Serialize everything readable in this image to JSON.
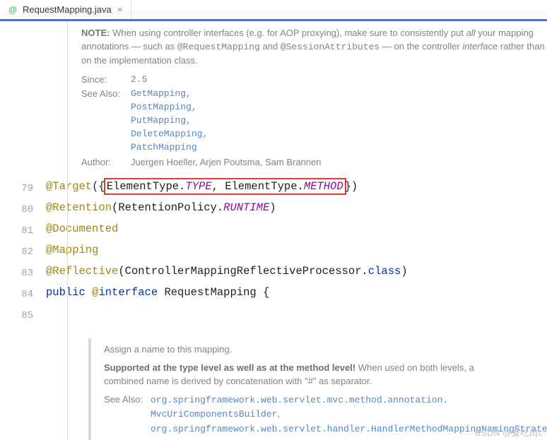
{
  "tab": {
    "icon": "@",
    "label": "RequestMapping.java",
    "close": "×"
  },
  "doc": {
    "noteLabel": "NOTE:",
    "noteBody1": " When using controller interfaces (e.g. for AOP proxying), make sure to consistently put ",
    "noteEm": "all",
    "noteBody2": " your mapping annotations — such as ",
    "noteCode1": "@RequestMapping",
    "noteBody3": " and ",
    "noteCode2": "@SessionAttributes",
    "noteBody4": " — on the controller ",
    "noteEm2": "interface",
    "noteBody5": " rather than on the implementation class.",
    "sinceLabel": "Since:",
    "sinceVal": "2.5",
    "seeAlsoLabel": "See Also:",
    "seeAlso": [
      "GetMapping",
      "PostMapping",
      "PutMapping",
      "DeleteMapping",
      "PatchMapping"
    ],
    "authorLabel": "Author:",
    "authorVal": "Juergen Hoeller, Arjen Poutsma, Sam Brannen"
  },
  "gutter": [
    "79",
    "80",
    "81",
    "82",
    "83",
    "84",
    "85"
  ],
  "code": {
    "l79": {
      "a": "@Target",
      "p1": "({",
      "b1": "ElementType.",
      "c1": "TYPE",
      "sep": ", ",
      "b2": "ElementType.",
      "c2": "METHOD",
      "p2": "})"
    },
    "l80": {
      "a": "@Retention",
      "p1": "(",
      "b": "RetentionPolicy.",
      "c": "RUNTIME",
      "p2": ")"
    },
    "l81": "@Documented",
    "l82": "@Mapping",
    "l83": {
      "a": "@Reflective",
      "p1": "(",
      "b": "ControllerMappingReflectiveProcessor.",
      "kw": "class",
      "p2": ")"
    },
    "l84": {
      "kw1": "public ",
      "a": "@",
      "kw2": "interface ",
      "name": "RequestMapping ",
      "brace": "{"
    }
  },
  "doc2": {
    "p1": "Assign a name to this mapping.",
    "p2a": "Supported at the type level as well as at the method level!",
    "p2b": " When used on both levels, a combined name is derived by concatenation with \"#\" as separator.",
    "seeAlsoLabel": "See Also:",
    "seeAlso1a": "org.springframework.web.servlet.mvc.method.annotation.",
    "seeAlso1b": "MvcUriComponentsBuilder",
    "seeAlso2": "org.springframework.web.servlet.handler.HandlerMethodMappingNamingStrategy"
  },
  "watermark": "CSDN @爱吃肉c"
}
